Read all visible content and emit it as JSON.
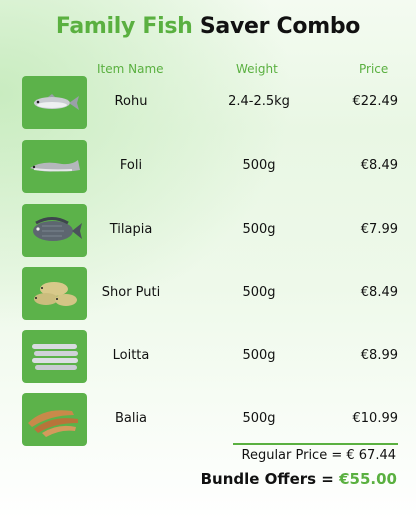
{
  "title": {
    "part1": "Family Fish",
    "part2": "Saver Combo"
  },
  "headers": {
    "name": "Item Name",
    "weight": "Weight",
    "price": "Price"
  },
  "items": [
    {
      "name": "Rohu",
      "weight": "2.4-2.5kg",
      "price": "€22.49",
      "icon": "rohu-fish-icon"
    },
    {
      "name": "Foli",
      "weight": "500g",
      "price": "€8.49",
      "icon": "foli-fish-icon"
    },
    {
      "name": "Tilapia",
      "weight": "500g",
      "price": "€7.99",
      "icon": "tilapia-fish-icon"
    },
    {
      "name": "Shor Puti",
      "weight": "500g",
      "price": "€8.49",
      "icon": "puti-fish-icon"
    },
    {
      "name": "Loitta",
      "weight": "500g",
      "price": "€8.99",
      "icon": "loitta-fish-icon"
    },
    {
      "name": "Balia",
      "weight": "500g",
      "price": "€10.99",
      "icon": "balia-fish-icon"
    }
  ],
  "summary": {
    "regular_label": "Regular Price =",
    "regular_value": "€ 67.44",
    "bundle_label": "Bundle Offers =",
    "bundle_value": "€55.00"
  },
  "colors": {
    "accent": "#5ab040",
    "tile": "#5cb24a",
    "text": "#111111"
  }
}
